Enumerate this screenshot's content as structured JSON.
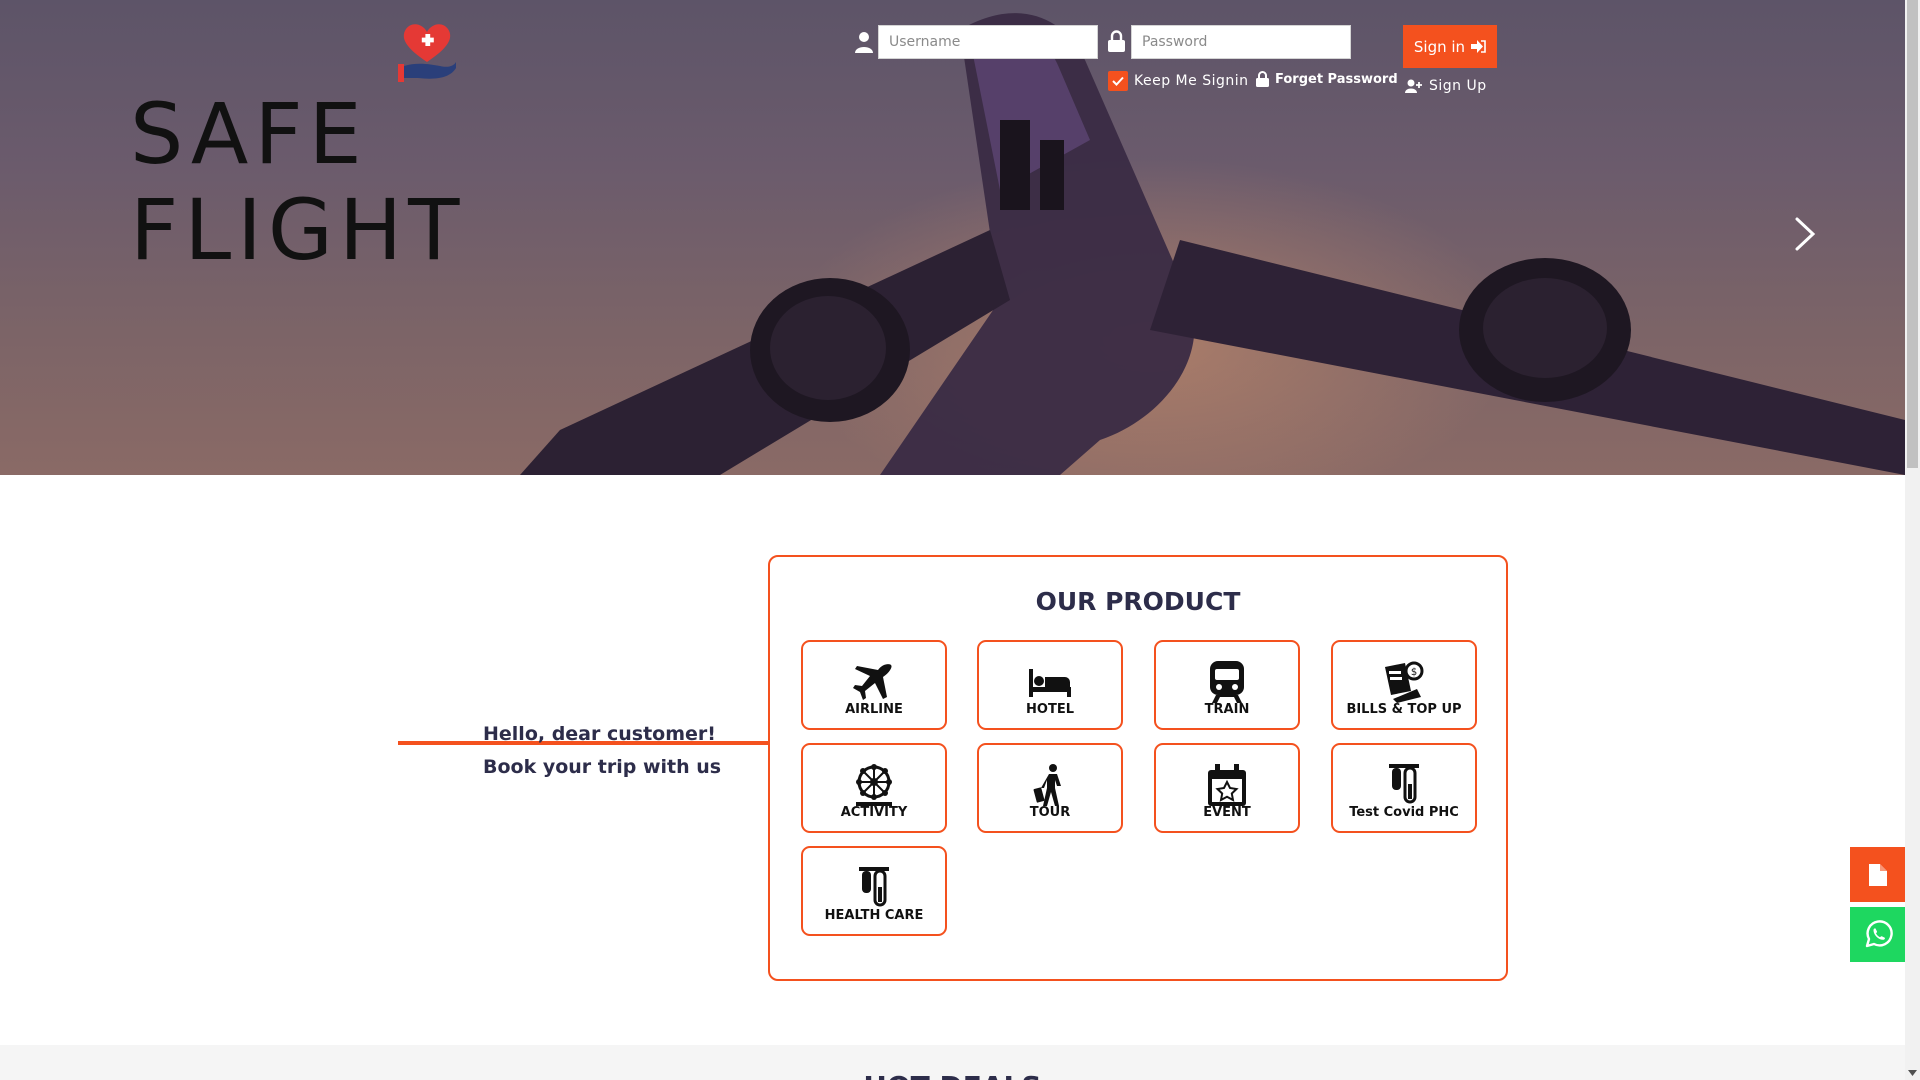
{
  "brand": {
    "logo_line1": "SAFE",
    "logo_line2": "FLIGHT"
  },
  "login": {
    "username_placeholder": "Username",
    "password_placeholder": "Password",
    "signin_label": "Sign in",
    "keep_label": "Keep Me Signin",
    "forget_label": "Forget Password",
    "signup_label": "Sign Up"
  },
  "greeting": {
    "line1": "Hello, dear customer!",
    "line2": "Book your trip with us"
  },
  "products": {
    "title": "OUR PRODUCT",
    "items": [
      {
        "label": "AIRLINE",
        "icon": "plane-icon"
      },
      {
        "label": "HOTEL",
        "icon": "bed-icon"
      },
      {
        "label": "TRAIN",
        "icon": "train-icon"
      },
      {
        "label": "BILLS & TOP UP",
        "icon": "bills-icon"
      },
      {
        "label": "ACTIVITY",
        "icon": "ferris-wheel-icon"
      },
      {
        "label": "TOUR",
        "icon": "traveler-icon"
      },
      {
        "label": "EVENT",
        "icon": "calendar-star-icon"
      },
      {
        "label": "Test Covid PHC",
        "icon": "test-tube-icon"
      },
      {
        "label": "HEALTH CARE",
        "icon": "test-tube-icon"
      }
    ]
  },
  "hot_deals": {
    "title": "HOT DEALS"
  },
  "colors": {
    "accent": "#f4511e",
    "whatsapp": "#1ed760",
    "text_dark": "#2d2d4a"
  }
}
